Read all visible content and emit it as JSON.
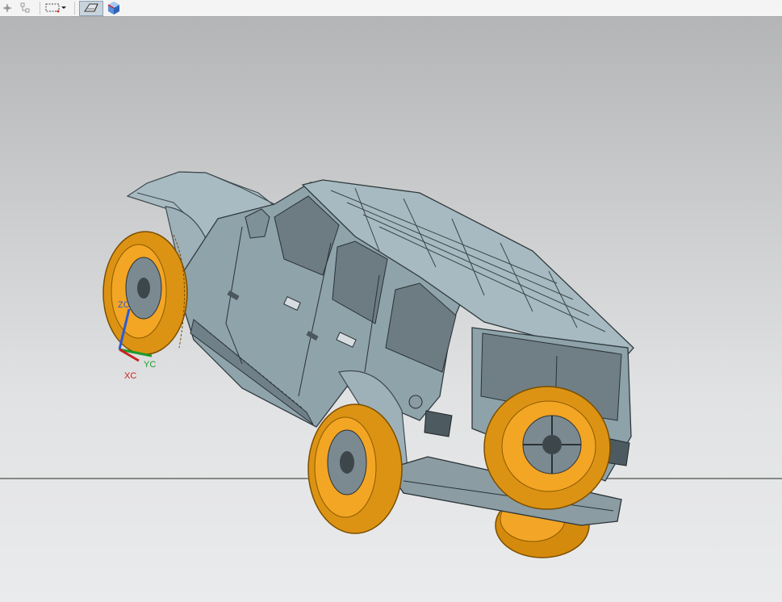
{
  "toolbar": {
    "buttons": [
      {
        "icon": "snap-point-icon"
      },
      {
        "icon": "assembly-tree-icon"
      },
      {
        "icon": "select-rectangle-icon"
      },
      {
        "icon": "dropdown-arrow-icon"
      },
      {
        "icon": "render-style-shaded-edges-icon",
        "active": true
      },
      {
        "icon": "view-cube-icon"
      }
    ]
  },
  "viewport": {
    "background_top": "#b4b5b6",
    "background_bottom": "#eaebec",
    "model": "jeep-wrangler-4-door",
    "body_color": "#8ea3ab",
    "tire_color": "#e89a10",
    "triad": {
      "z_label": "ZC",
      "y_label": "YC",
      "x_label": "XC",
      "z_color": "#2a5bd7",
      "y_color": "#1e9a2a",
      "x_color": "#cc2020"
    }
  }
}
